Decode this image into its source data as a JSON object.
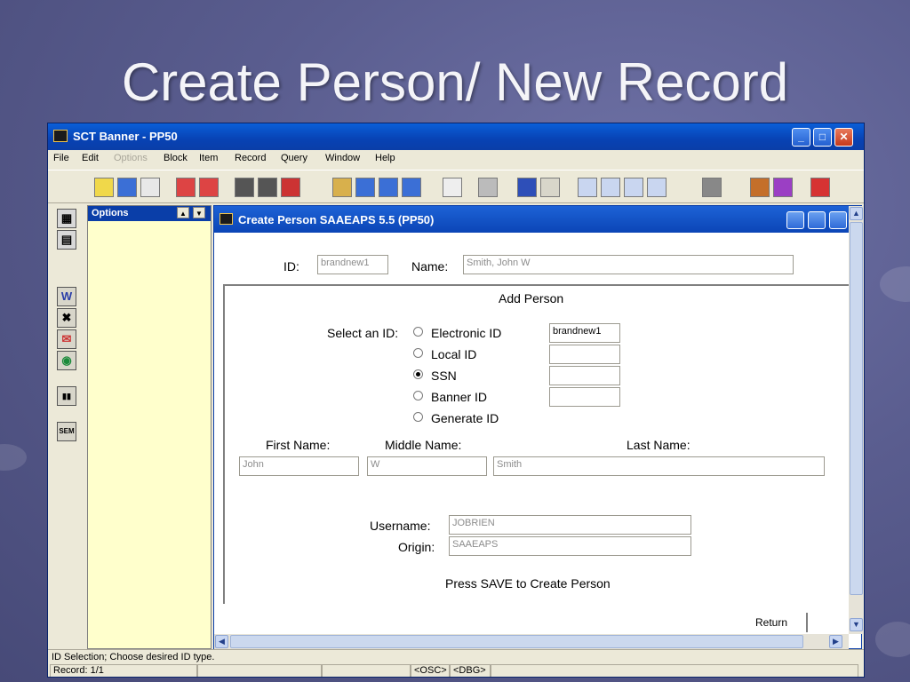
{
  "slide": {
    "title": "Create Person/ New Record"
  },
  "window": {
    "title": "SCT Banner - PP50"
  },
  "menu": [
    "File",
    "Edit",
    "Options",
    "Block",
    "Item",
    "Record",
    "Query",
    "Window",
    "Help"
  ],
  "options_panel": {
    "title": "Options"
  },
  "child": {
    "title": "Create Person  SAAEAPS  5.5  (PP50)",
    "id_label": "ID:",
    "id_value": "brandnew1",
    "name_label": "Name:",
    "name_value": "Smith, John W",
    "section_title": "Add Person",
    "select_id_label": "Select an ID:",
    "id_options": [
      {
        "label": "Electronic ID",
        "value": "brandnew1",
        "checked": false
      },
      {
        "label": "Local ID",
        "value": "",
        "checked": false
      },
      {
        "label": "SSN",
        "value": "",
        "checked": true
      },
      {
        "label": "Banner ID",
        "value": "",
        "checked": false
      },
      {
        "label": "Generate ID",
        "checked": false
      }
    ],
    "first_name_label": "First Name:",
    "middle_name_label": "Middle Name:",
    "last_name_label": "Last Name:",
    "first_name": "John",
    "middle_name": "W",
    "last_name": "Smith",
    "username_label": "Username:",
    "username": "JOBRIEN",
    "origin_label": "Origin:",
    "origin": "SAAEAPS",
    "save_hint": "Press SAVE to Create Person",
    "return_label": "Return"
  },
  "status": {
    "message": "ID Selection; Choose desired ID type.",
    "record": "Record: 1/1",
    "osc": "<OSC>",
    "dbg": "<DBG>"
  }
}
